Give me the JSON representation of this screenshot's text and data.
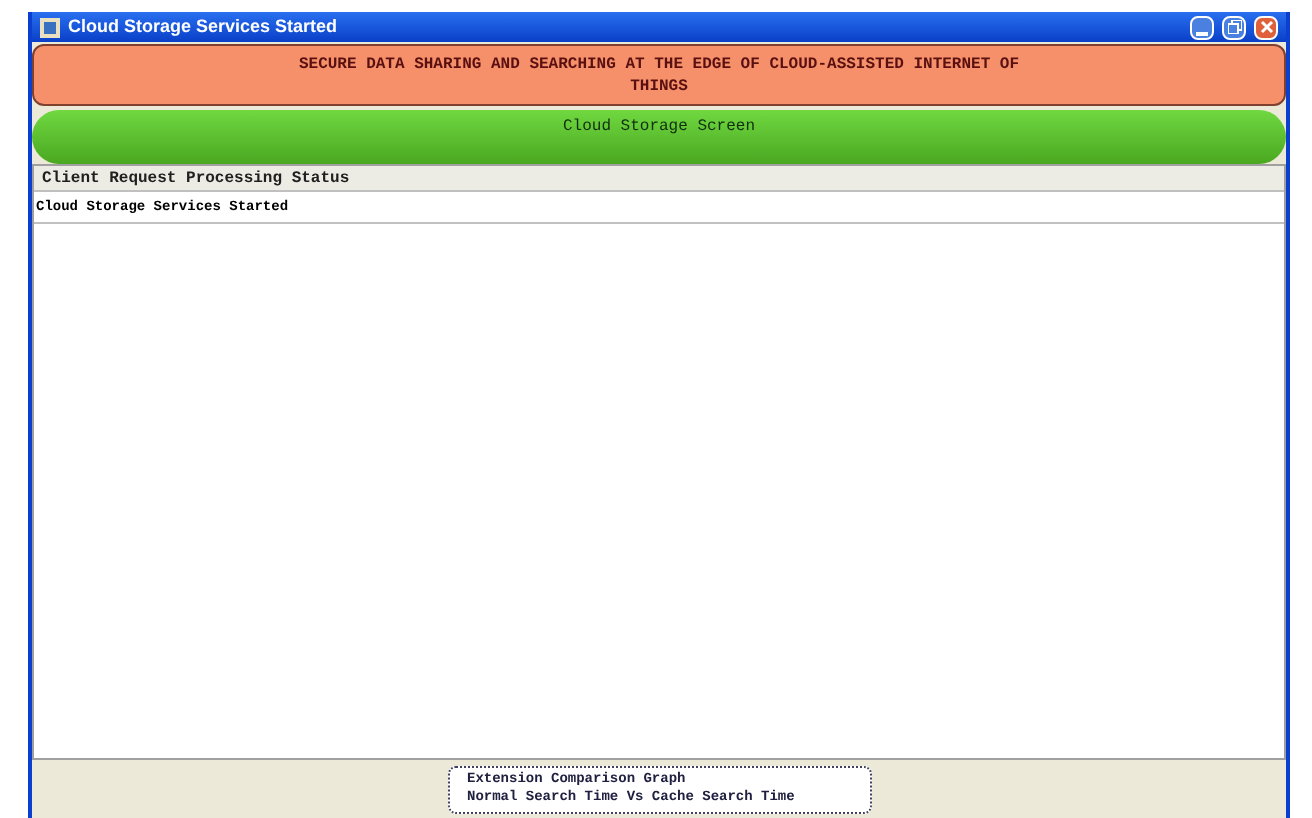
{
  "window": {
    "title": "Cloud Storage Services Started"
  },
  "banner": {
    "title": "SECURE DATA SHARING AND SEARCHING AT THE EDGE OF CLOUD-ASSISTED INTERNET OF THINGS"
  },
  "screen_header": {
    "title": "Cloud Storage Screen"
  },
  "table": {
    "columns": [
      "Client Request Processing Status"
    ],
    "rows": [
      [
        "Cloud Storage Services Started"
      ]
    ]
  },
  "buttons": [
    {
      "lines": [
        "Extension Comparison Graph",
        "Normal Search Time Vs Cache Search Time"
      ]
    }
  ]
}
